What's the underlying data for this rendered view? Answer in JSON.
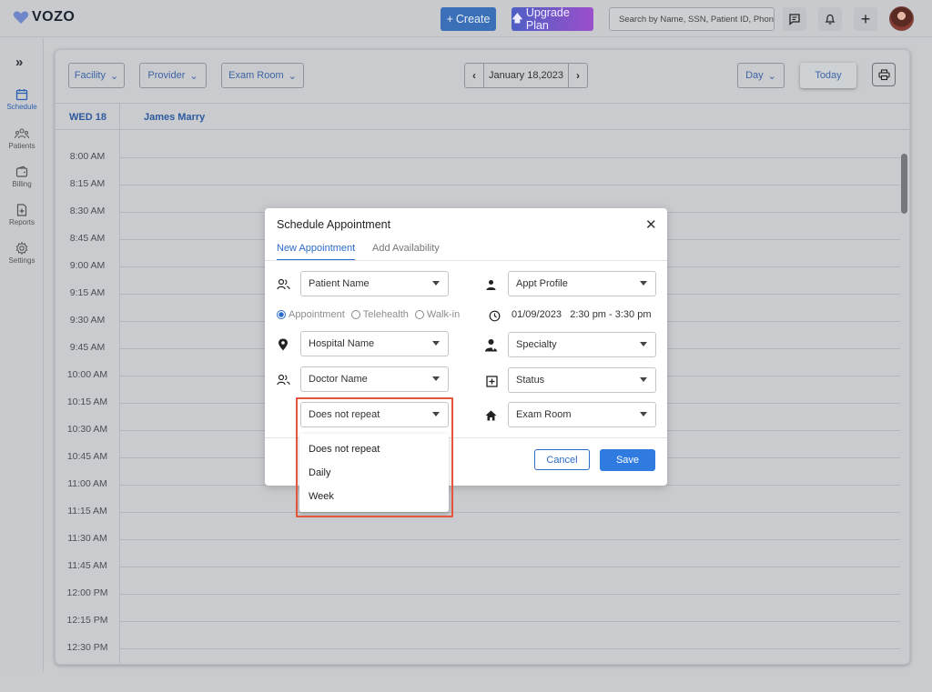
{
  "app": {
    "logo_text": "VOZO"
  },
  "topbar": {
    "create_label": "Create",
    "upgrade_label": "Upgrade Plan",
    "search_placeholder": "Search by Name, SSN, Patient ID, Phone"
  },
  "sidebar": {
    "items": [
      {
        "label": "Schedule",
        "icon": "calendar-icon"
      },
      {
        "label": "Patients",
        "icon": "patients-icon"
      },
      {
        "label": "Billing",
        "icon": "wallet-icon"
      },
      {
        "label": "Reports",
        "icon": "report-icon"
      },
      {
        "label": "Settings",
        "icon": "gear-icon"
      }
    ]
  },
  "filters": {
    "facility": "Facility",
    "provider": "Provider",
    "exam_room": "Exam Room",
    "view": "Day"
  },
  "date_nav": {
    "label": "January 18,2023"
  },
  "today_label": "Today",
  "schedule": {
    "day_label": "WED 18",
    "provider_name": "James Marry",
    "times": [
      "8:00 AM",
      "8:15 AM",
      "8:30 AM",
      "8:45 AM",
      "9:00 AM",
      "9:15 AM",
      "9:30 AM",
      "9:45 AM",
      "10:00 AM",
      "10:15 AM",
      "10:30 AM",
      "10:45 AM",
      "11:00 AM",
      "11:15 AM",
      "11:30 AM",
      "11:45 AM",
      "12:00 PM",
      "12:15 PM",
      "12:30 PM"
    ]
  },
  "modal": {
    "title": "Schedule Appointment",
    "tabs": [
      "New Appointment",
      "Add Availability"
    ],
    "patient_name": "Patient Name",
    "appt_profile": "Appt Profile",
    "radio_options": [
      "Appointment",
      "Telehealth",
      "Walk-in"
    ],
    "datetime": "01/09/2023   2:30 pm - 3:30 pm",
    "hospital_name": "Hospital Name",
    "specialty": "Specialty",
    "doctor_name": "Doctor Name",
    "status": "Status",
    "repeat": "Does not repeat",
    "exam_room": "Exam Room",
    "cancel_label": "Cancel",
    "save_label": "Save"
  },
  "repeat_options": [
    "Does not repeat",
    "Daily",
    "Week"
  ],
  "colors": {
    "accent": "#2b6bc9",
    "save": "#2f7be0",
    "highlight": "#e4553c"
  }
}
